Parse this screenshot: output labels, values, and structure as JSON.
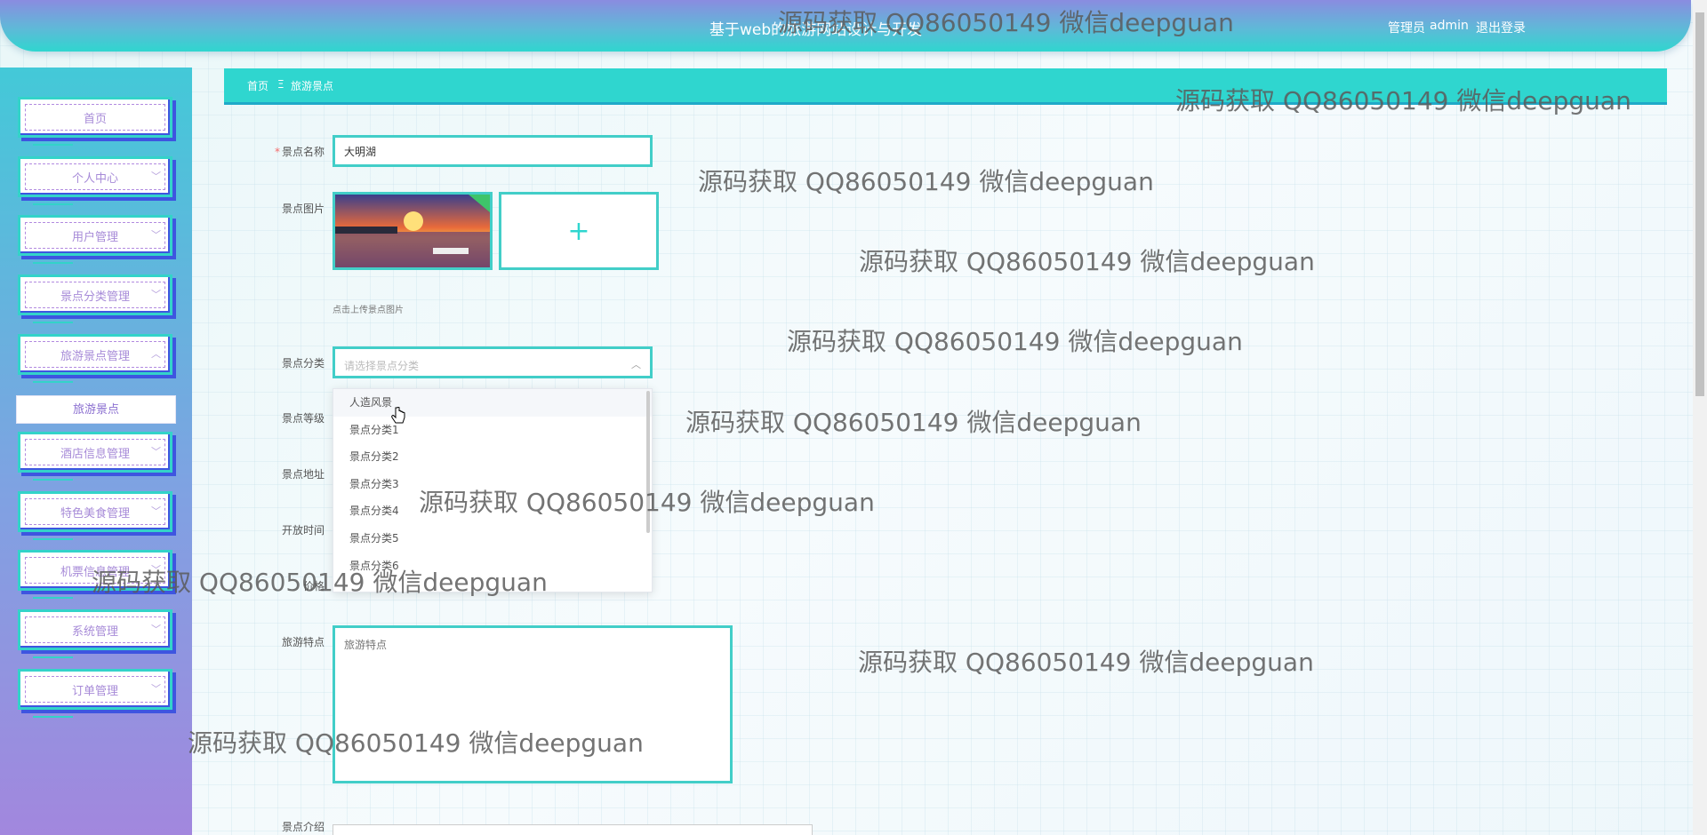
{
  "header": {
    "title": "基于web的旅游网站设计与开发",
    "user_role": "管理员",
    "user_name": "admin",
    "logout": "退出登录"
  },
  "sidebar": {
    "items": [
      {
        "label": "首页",
        "has_chevron": false
      },
      {
        "label": "个人中心",
        "has_chevron": true
      },
      {
        "label": "用户管理",
        "has_chevron": true
      },
      {
        "label": "景点分类管理",
        "has_chevron": true
      },
      {
        "label": "旅游景点管理",
        "has_chevron": true,
        "expanded": true
      },
      {
        "label": "酒店信息管理",
        "has_chevron": true
      },
      {
        "label": "特色美食管理",
        "has_chevron": true
      },
      {
        "label": "机票信息管理",
        "has_chevron": true
      },
      {
        "label": "系统管理",
        "has_chevron": true
      },
      {
        "label": "订单管理",
        "has_chevron": true
      }
    ],
    "active_sub": "旅游景点"
  },
  "breadcrumb": {
    "home": "首页",
    "separator": "Ξ",
    "current": "旅游景点"
  },
  "form": {
    "name_label": "景点名称",
    "name_value": "大明湖",
    "image_label": "景点图片",
    "upload_tip": "点击上传景点图片",
    "category_label": "景点分类",
    "category_placeholder": "请选择景点分类",
    "category_options": [
      "人造风景",
      "景点分类1",
      "景点分类2",
      "景点分类3",
      "景点分类4",
      "景点分类5",
      "景点分类6"
    ],
    "grade_label": "景点等级",
    "address_label": "景点地址",
    "hours_label": "开放时间",
    "price_label": "价格",
    "features_label": "旅游特点",
    "features_placeholder": "旅游特点",
    "intro_label": "景点介绍"
  },
  "watermark": "源码获取 QQ86050149 微信deepguan"
}
